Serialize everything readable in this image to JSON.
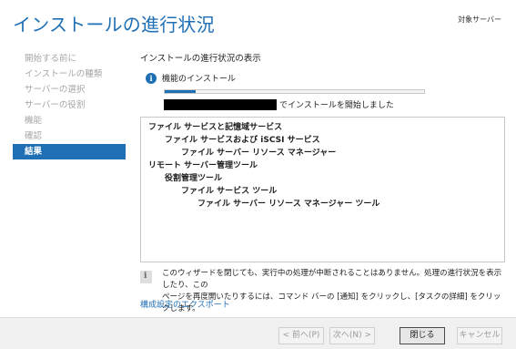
{
  "header": {
    "title": "インストールの進行状況",
    "target_server": "対象サーバー"
  },
  "nav": {
    "items": [
      {
        "label": "開始する前に",
        "active": false
      },
      {
        "label": "インストールの種類",
        "active": false
      },
      {
        "label": "サーバーの選択",
        "active": false
      },
      {
        "label": "サーバーの役割",
        "active": false
      },
      {
        "label": "機能",
        "active": false
      },
      {
        "label": "確認",
        "active": false
      },
      {
        "label": "結果",
        "active": true
      }
    ]
  },
  "main": {
    "section_title": "インストールの進行状況の表示",
    "feature_install_label": "機能のインストール",
    "progress": 0.12,
    "status_text": "でインストールを開始しました",
    "feature_list": [
      {
        "label": "ファイル サービスと記憶域サービス",
        "level": 0
      },
      {
        "label": "ファイル サービスおよび iSCSI サービス",
        "level": 1
      },
      {
        "label": "ファイル サーバー リソース マネージャー",
        "level": 2
      },
      {
        "label": "リモート サーバー管理ツール",
        "level": 0
      },
      {
        "label": "役割管理ツール",
        "level": 1
      },
      {
        "label": "ファイル サービス ツール",
        "level": 2
      },
      {
        "label": "ファイル サーバー リソース マネージャー ツール",
        "level": 3
      }
    ],
    "notice_line1": "このウィザードを閉じても、実行中の処理が中断されることはありません。処理の進行状況を表示したり、この",
    "notice_line2": "ページを再度開いたりするには、コマンド バーの [通知] をクリックし、[タスクの詳細] をクリックします。",
    "export_link": "構成設定のエクスポート"
  },
  "footer": {
    "prev_label": "< 前へ(P)",
    "next_label": "次へ(N) >",
    "close_label": "閉じる",
    "cancel_label": "キャンセル"
  },
  "colors": {
    "accent": "#1f6fb5",
    "redacted": "#000000"
  }
}
